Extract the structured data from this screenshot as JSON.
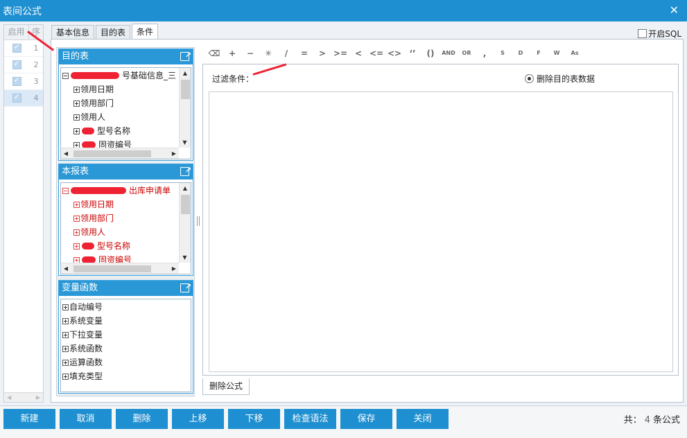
{
  "window": {
    "title": "表间公式",
    "close": "✕"
  },
  "grid": {
    "col_enabled": "启用",
    "col_seq": "序",
    "rows": [
      {
        "num": "1"
      },
      {
        "num": "2"
      },
      {
        "num": "3"
      },
      {
        "num": "4"
      }
    ]
  },
  "tabs": [
    "基本信息",
    "目的表",
    "条件"
  ],
  "sql_option": "开启SQL",
  "target_table": {
    "title": "目的表",
    "root": "号基础信息_三",
    "items": [
      "领用日期",
      "领用部门",
      "领用人",
      "型号名称",
      "固资编号"
    ]
  },
  "this_table": {
    "title": "本报表",
    "root": "出库申请单",
    "items": [
      "领用日期",
      "领用部门",
      "领用人",
      "型号名称",
      "固资编号"
    ]
  },
  "variables": {
    "title": "变量函数",
    "items": [
      "自动编号",
      "系统变量",
      "下拉变量",
      "系统函数",
      "运算函数",
      "填充类型"
    ]
  },
  "toolbar": [
    "+",
    "−",
    "✳",
    "/",
    "=",
    ">",
    ">=",
    "<",
    "<=",
    "<>",
    "‘’",
    "()",
    "AND",
    "OR",
    ",",
    "S",
    "D",
    "F",
    "W",
    "As"
  ],
  "editor": {
    "filter_label": "过滤条件：",
    "delete_target_option": "删除目的表数据"
  },
  "bottom_tab": "删除公式",
  "buttons": [
    "新建",
    "取消",
    "删除",
    "上移",
    "下移",
    "检查语法",
    "保存",
    "关闭"
  ],
  "total": {
    "prefix": "共：",
    "count": "4",
    "suffix": "条公式"
  },
  "colors": {
    "accent": "#1e8fd0",
    "redaction": "#e02030"
  }
}
